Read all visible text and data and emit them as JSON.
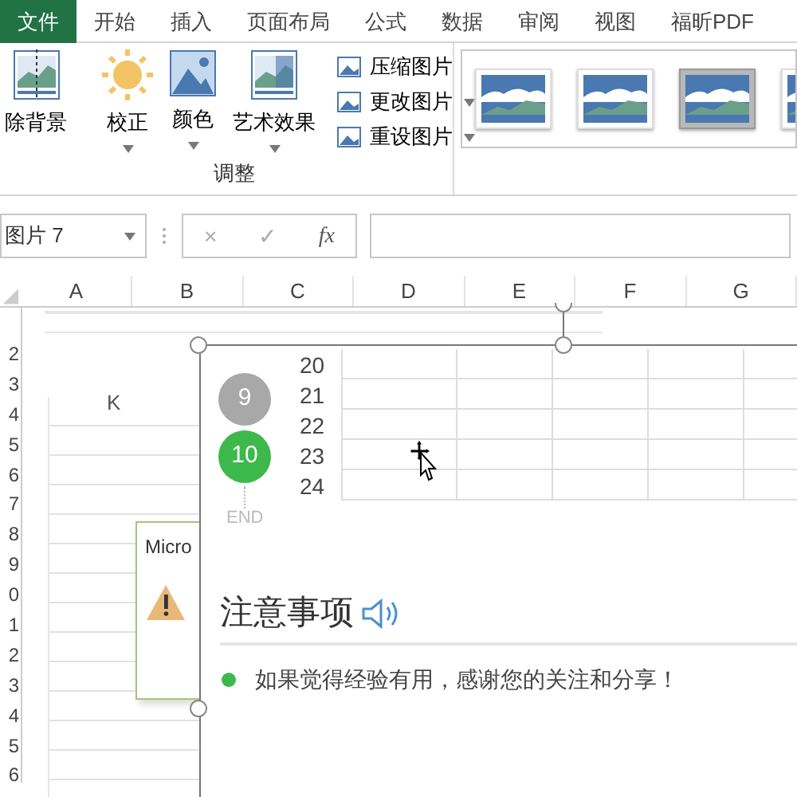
{
  "ribbon_tabs": [
    {
      "label": "文件",
      "selected": true
    },
    {
      "label": "开始",
      "selected": false
    },
    {
      "label": "插入",
      "selected": false
    },
    {
      "label": "页面布局",
      "selected": false
    },
    {
      "label": "公式",
      "selected": false
    },
    {
      "label": "数据",
      "selected": false
    },
    {
      "label": "审阅",
      "selected": false
    },
    {
      "label": "视图",
      "selected": false
    },
    {
      "label": "福昕PDF",
      "selected": false
    }
  ],
  "ribbon": {
    "large_buttons": [
      {
        "label": "除背景",
        "kind": "remove",
        "dropdown": false
      },
      {
        "label": "校正",
        "kind": "sun",
        "dropdown": true
      },
      {
        "label": "颜色",
        "kind": "color",
        "dropdown": true
      },
      {
        "label": "艺术效果",
        "kind": "art",
        "dropdown": true
      }
    ],
    "small_buttons": [
      {
        "label": "压缩图片",
        "dropdown": false
      },
      {
        "label": "更改图片",
        "dropdown": true
      },
      {
        "label": "重设图片",
        "dropdown": true
      }
    ],
    "group_label": "调整",
    "styles": [
      {
        "selected": false
      },
      {
        "selected": false
      },
      {
        "selected": true
      },
      {
        "selected": false
      }
    ]
  },
  "formula_bar": {
    "name_box": "图片 7",
    "buttons": [
      "×",
      "✓",
      "fx"
    ]
  },
  "columns": [
    "A",
    "B",
    "C",
    "D",
    "E",
    "F",
    "G"
  ],
  "rows": [
    "2",
    "3",
    "4",
    "5",
    "6",
    "7",
    "8",
    "9",
    "0",
    "1",
    "2",
    "3",
    "4",
    "5",
    "6"
  ],
  "background_picture": {
    "column_header": "K",
    "dialog_title": "Micro"
  },
  "selected_picture": {
    "steps": [
      {
        "label": "9",
        "active": false
      },
      {
        "label": "10",
        "active": true
      }
    ],
    "row_numbers": [
      "20",
      "21",
      "22",
      "23",
      "24"
    ],
    "end_label": "END",
    "tip_title": "注意事项",
    "tip_text": "如果觉得经验有用，感谢您的关注和分享！"
  }
}
